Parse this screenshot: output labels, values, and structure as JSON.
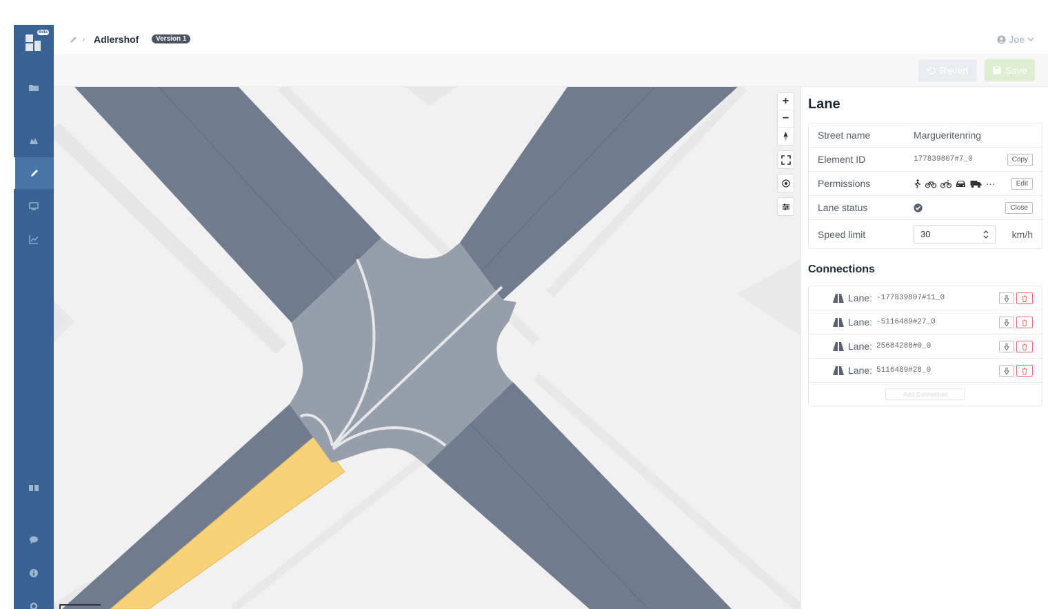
{
  "sidebar": {
    "beta_label": "Beta",
    "items": [
      {
        "icon": "folder-icon"
      },
      {
        "icon": "map-icon"
      },
      {
        "icon": "pencil-icon",
        "active": true
      },
      {
        "icon": "monitor-icon"
      },
      {
        "icon": "chart-icon"
      },
      {
        "icon": "book-icon"
      },
      {
        "icon": "chat-icon"
      },
      {
        "icon": "info-icon"
      },
      {
        "icon": "gear-icon"
      }
    ]
  },
  "header": {
    "title": "Adlershof",
    "version": "Version 1",
    "user": "Joe"
  },
  "toolbar": {
    "revert_label": "Revert",
    "save_label": "Save"
  },
  "map": {
    "controls": [
      "+",
      "−"
    ],
    "highlight_color": "#f7d27a",
    "road_color": "#707b8f",
    "junction_color": "#979eab"
  },
  "panel": {
    "title": "Lane",
    "properties": {
      "street_name": {
        "label": "Street name",
        "value": "Margueritenring"
      },
      "element_id": {
        "label": "Element ID",
        "value": "177839807#7_0",
        "button": "Copy"
      },
      "permissions": {
        "label": "Permissions",
        "icons": [
          "pedestrian-icon",
          "bicycle-icon",
          "motorcycle-icon",
          "car-icon",
          "truck-icon"
        ],
        "more": "···",
        "button": "Edit"
      },
      "lane_status": {
        "label": "Lane status",
        "button": "Close"
      },
      "speed_limit": {
        "label": "Speed limit",
        "value": "30",
        "unit": "km/h"
      }
    },
    "connections_title": "Connections",
    "connections": [
      {
        "label": "Lane:",
        "id": "-177839807#11_0"
      },
      {
        "label": "Lane:",
        "id": "-5116489#27_0"
      },
      {
        "label": "Lane:",
        "id": "25684288#0_0"
      },
      {
        "label": "Lane:",
        "id": "5116489#28_0"
      }
    ],
    "add_connection": "Add Connection"
  }
}
